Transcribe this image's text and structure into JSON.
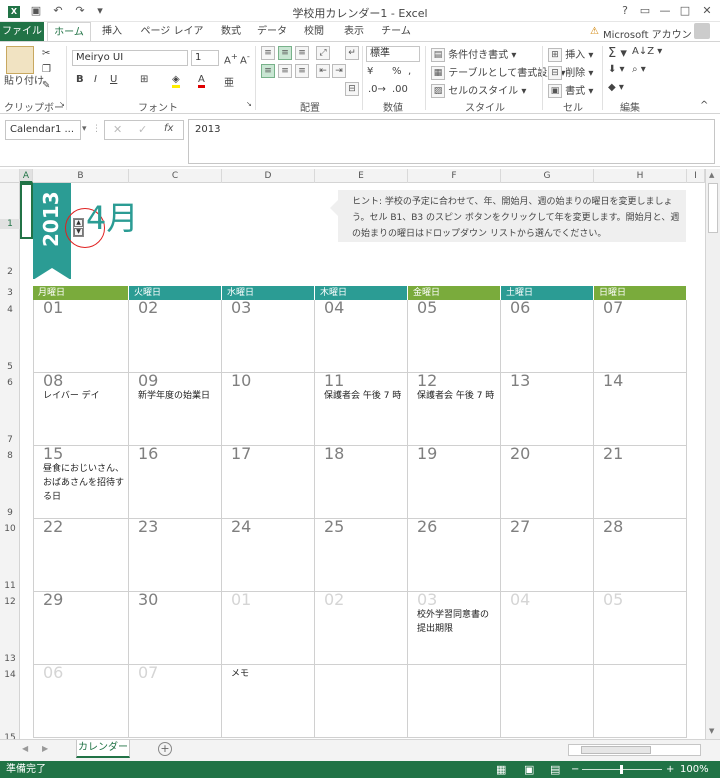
{
  "window": {
    "title": "学校用カレンダー1 - Excel",
    "help": "?",
    "min": "—",
    "max": "□",
    "close": "✕"
  },
  "tabs": [
    "ファイル",
    "ホーム",
    "挿入",
    "ページ レイアウト",
    "数式",
    "データ",
    "校閲",
    "表示",
    "チーム"
  ],
  "account": "Microsoft アカウント",
  "ribbon": {
    "paste": "貼り付け",
    "clipboard": "クリップボード",
    "font_name": "Meiryo UI",
    "font_size": "1",
    "font": "フォント",
    "alignment": "配置",
    "number_format": "標準",
    "number": "数値",
    "cond_format": "条件付き書式",
    "table_format": "テーブルとして書式設定",
    "cell_style": "セルのスタイル",
    "styles": "スタイル",
    "insert": "挿入",
    "delete": "削除",
    "format": "書式",
    "cells": "セル",
    "editing": "編集"
  },
  "formula_bar": {
    "name_box": "Calendar1 ...",
    "fx": "fx",
    "value": "2013"
  },
  "columns": [
    "A",
    "B",
    "C",
    "D",
    "E",
    "F",
    "G",
    "H",
    "I"
  ],
  "rows": [
    "1",
    "2",
    "3",
    "4",
    "5",
    "6",
    "7",
    "8",
    "9",
    "10",
    "11",
    "12",
    "13",
    "14",
    "15"
  ],
  "calendar": {
    "year": "2013",
    "month": "4月",
    "hint": "ヒント: 学校の予定に合わせて、年、開始月、週の始まりの曜日を変更しましょう。セル B1、B3 のスピン ボタンをクリックして年を変更します。開始月と、週の始まりの曜日はドロップダウン リストから選んでください。",
    "weekdays": [
      "月曜日",
      "火曜日",
      "水曜日",
      "木曜日",
      "金曜日",
      "土曜日",
      "日曜日"
    ],
    "weeks": [
      [
        {
          "d": "01"
        },
        {
          "d": "02"
        },
        {
          "d": "03"
        },
        {
          "d": "04"
        },
        {
          "d": "05"
        },
        {
          "d": "06"
        },
        {
          "d": "07"
        }
      ],
      [
        {
          "d": "08",
          "n": "レイバー デイ"
        },
        {
          "d": "09",
          "n": "新学年度の始業日"
        },
        {
          "d": "10"
        },
        {
          "d": "11",
          "n": "保護者会 午後 7 時"
        },
        {
          "d": "12",
          "n": "保護者会 午後 7 時"
        },
        {
          "d": "13"
        },
        {
          "d": "14"
        }
      ],
      [
        {
          "d": "15",
          "n": "昼食におじいさん、おばあさんを招待する日"
        },
        {
          "d": "16"
        },
        {
          "d": "17"
        },
        {
          "d": "18"
        },
        {
          "d": "19"
        },
        {
          "d": "20"
        },
        {
          "d": "21"
        }
      ],
      [
        {
          "d": "22"
        },
        {
          "d": "23"
        },
        {
          "d": "24"
        },
        {
          "d": "25"
        },
        {
          "d": "26"
        },
        {
          "d": "27"
        },
        {
          "d": "28"
        }
      ],
      [
        {
          "d": "29"
        },
        {
          "d": "30"
        },
        {
          "d": "01",
          "dim": true
        },
        {
          "d": "02",
          "dim": true
        },
        {
          "d": "03",
          "dim": true,
          "n": "校外学習同意書の提出期限"
        },
        {
          "d": "04",
          "dim": true
        },
        {
          "d": "05",
          "dim": true
        }
      ],
      [
        {
          "d": "06",
          "dim": true
        },
        {
          "d": "07",
          "dim": true
        },
        {
          "d": "",
          "n": "メモ"
        },
        {
          "d": ""
        },
        {
          "d": ""
        },
        {
          "d": ""
        },
        {
          "d": ""
        }
      ]
    ],
    "header_colors": [
      "#7aab3c",
      "#2b9c94",
      "#2b9c94",
      "#2b9c94",
      "#7aab3c",
      "#2b9c94",
      "#7aab3c"
    ]
  },
  "sheet_tab": "カレンダー",
  "status": {
    "ready": "準備完了",
    "zoom": "100%"
  }
}
